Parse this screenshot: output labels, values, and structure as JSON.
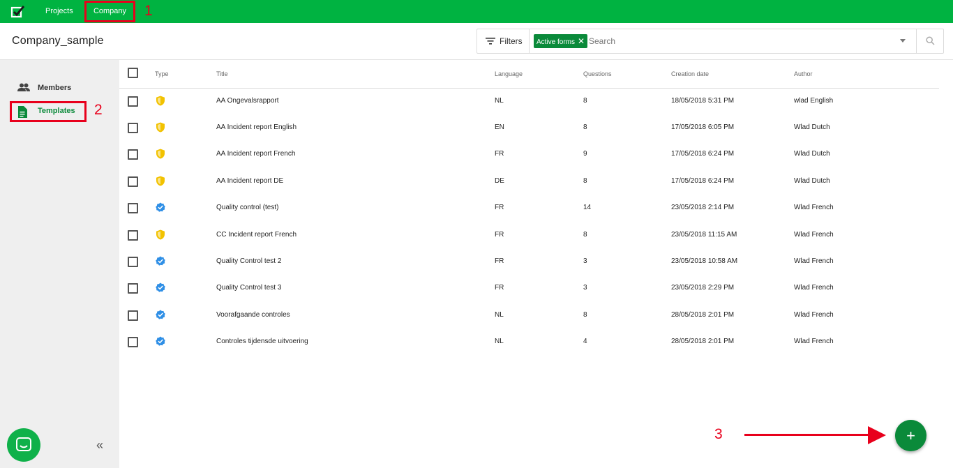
{
  "topbar": {
    "nav": [
      "Projects",
      "Company"
    ],
    "accent": "#00b341"
  },
  "annotations": [
    "1",
    "2",
    "3"
  ],
  "header": {
    "title": "Company_sample",
    "filters_label": "Filters",
    "chip_label": "Active forms",
    "search_placeholder": "Search"
  },
  "sidebar": {
    "items": [
      {
        "label": "Members",
        "icon": "people-icon"
      },
      {
        "label": "Templates",
        "icon": "document-icon"
      }
    ],
    "collapse_label": "«"
  },
  "table": {
    "columns": [
      "Type",
      "Title",
      "Language",
      "Questions",
      "Creation date",
      "Author"
    ],
    "rows": [
      {
        "type": "shield",
        "title": "AA Ongevalsrapport",
        "language": "NL",
        "questions": "8",
        "date": "18/05/2018 5:31 PM",
        "author": "wlad English"
      },
      {
        "type": "shield",
        "title": "AA Incident report English",
        "language": "EN",
        "questions": "8",
        "date": "17/05/2018 6:05 PM",
        "author": "Wlad Dutch"
      },
      {
        "type": "shield",
        "title": "AA Incident report French",
        "language": "FR",
        "questions": "9",
        "date": "17/05/2018 6:24 PM",
        "author": "Wlad Dutch"
      },
      {
        "type": "shield",
        "title": "AA Incident report DE",
        "language": "DE",
        "questions": "8",
        "date": "17/05/2018 6:24 PM",
        "author": "Wlad Dutch"
      },
      {
        "type": "verified",
        "title": "Quality control (test)",
        "language": "FR",
        "questions": "14",
        "date": "23/05/2018 2:14 PM",
        "author": "Wlad French"
      },
      {
        "type": "shield",
        "title": "CC Incident report French",
        "language": "FR",
        "questions": "8",
        "date": "23/05/2018 11:15 AM",
        "author": "Wlad French"
      },
      {
        "type": "verified",
        "title": "Quality Control test 2",
        "language": "FR",
        "questions": "3",
        "date": "23/05/2018 10:58 AM",
        "author": "Wlad French"
      },
      {
        "type": "verified",
        "title": "Quality Control test 3",
        "language": "FR",
        "questions": "3",
        "date": "23/05/2018 2:29 PM",
        "author": "Wlad French"
      },
      {
        "type": "verified",
        "title": "Voorafgaande controles",
        "language": "NL",
        "questions": "8",
        "date": "28/05/2018 2:01 PM",
        "author": "Wlad French"
      },
      {
        "type": "verified",
        "title": "Controles tijdensde uitvoering",
        "language": "NL",
        "questions": "4",
        "date": "28/05/2018 2:01 PM",
        "author": "Wlad French"
      }
    ]
  },
  "fab": {
    "label": "+"
  },
  "colors": {
    "shield": "#f2c200",
    "verified": "#2f8fe6",
    "brand_dark": "#0a8a3a",
    "highlight": "#e8001c"
  }
}
